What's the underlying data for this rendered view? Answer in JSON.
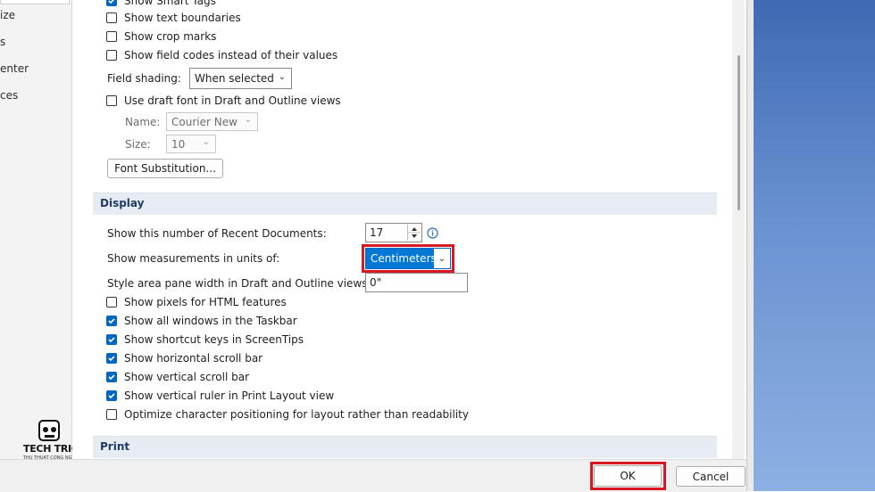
{
  "left_nav": {
    "items": [
      "ize",
      "s",
      "enter",
      "ces"
    ]
  },
  "advanced": {
    "checkboxes_top": [
      {
        "label": "Show Smart Tags",
        "checked": true
      },
      {
        "label": "Show text boundaries",
        "checked": false
      },
      {
        "label": "Show crop marks",
        "checked": false
      },
      {
        "label": "Show field codes instead of their values",
        "checked": false
      }
    ],
    "field_shading": {
      "label": "Field shading:",
      "value": "When selected"
    },
    "draft_font": {
      "label": "Use draft font in Draft and Outline views",
      "checked": false
    },
    "name": {
      "label": "Name:",
      "value": "Courier New"
    },
    "size": {
      "label": "Size:",
      "value": "10"
    },
    "font_substitution_button": "Font Substitution..."
  },
  "display": {
    "header": "Display",
    "recent_docs": {
      "label": "Show this number of Recent Documents:",
      "value": "17"
    },
    "measurements": {
      "label": "Show measurements in units of:",
      "value": "Centimeters"
    },
    "style_area": {
      "label": "Style area pane width in Draft and Outline views:",
      "value": "0\""
    },
    "checkboxes": [
      {
        "label": "Show pixels for HTML features",
        "checked": false
      },
      {
        "label": "Show all windows in the Taskbar",
        "checked": true
      },
      {
        "label": "Show shortcut keys in ScreenTips",
        "checked": true
      },
      {
        "label": "Show horizontal scroll bar",
        "checked": true
      },
      {
        "label": "Show vertical scroll bar",
        "checked": true
      },
      {
        "label": "Show vertical ruler in Print Layout view",
        "checked": true
      },
      {
        "label": "Optimize character positioning for layout rather than readability",
        "checked": false
      }
    ]
  },
  "print": {
    "header": "Print"
  },
  "footer": {
    "ok": "OK",
    "cancel": "Cancel"
  },
  "logo": {
    "text": "TECH TRICKS",
    "subtext": "THU THUAT CONG NGHE"
  },
  "colors": {
    "accent": "#0067c0",
    "highlight": "#d81822",
    "section_bg": "#e6ecf2"
  }
}
